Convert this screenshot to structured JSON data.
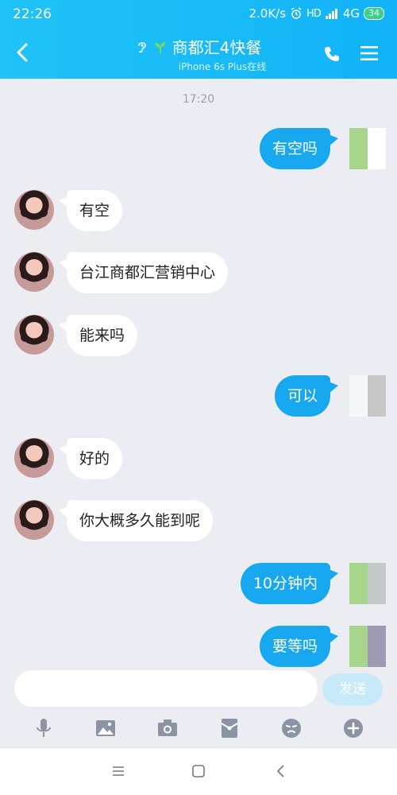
{
  "status": {
    "time": "22:26",
    "speed": "2.0K/s",
    "hd": "HD",
    "network": "4G",
    "battery": "34"
  },
  "nav": {
    "title": "商都汇4快餐",
    "subtitle": "iPhone 6s Plus在线"
  },
  "chat": {
    "timestamp": "17:20",
    "messages": [
      {
        "side": "out",
        "text": "有空吗"
      },
      {
        "side": "in",
        "text": "有空"
      },
      {
        "side": "in",
        "text": "台江商都汇营销中心"
      },
      {
        "side": "in",
        "text": "能来吗"
      },
      {
        "side": "out",
        "text": "可以"
      },
      {
        "side": "in",
        "text": "好的"
      },
      {
        "side": "in",
        "text": "你大概多久能到呢"
      },
      {
        "side": "out",
        "text": "10分钟内"
      },
      {
        "side": "out",
        "text": "要等吗"
      }
    ]
  },
  "input": {
    "value": "",
    "send_label": "发送"
  },
  "toolbar": {
    "icons": [
      "microphone-icon",
      "image-icon",
      "camera-icon",
      "red-packet-icon",
      "emoji-icon",
      "plus-icon"
    ]
  },
  "colors": {
    "header": "#12b3f7",
    "out_bubble": "#17a8ef",
    "in_bubble": "#ffffff",
    "background": "#ebedf2",
    "send_disabled": "#c7e9fa"
  }
}
